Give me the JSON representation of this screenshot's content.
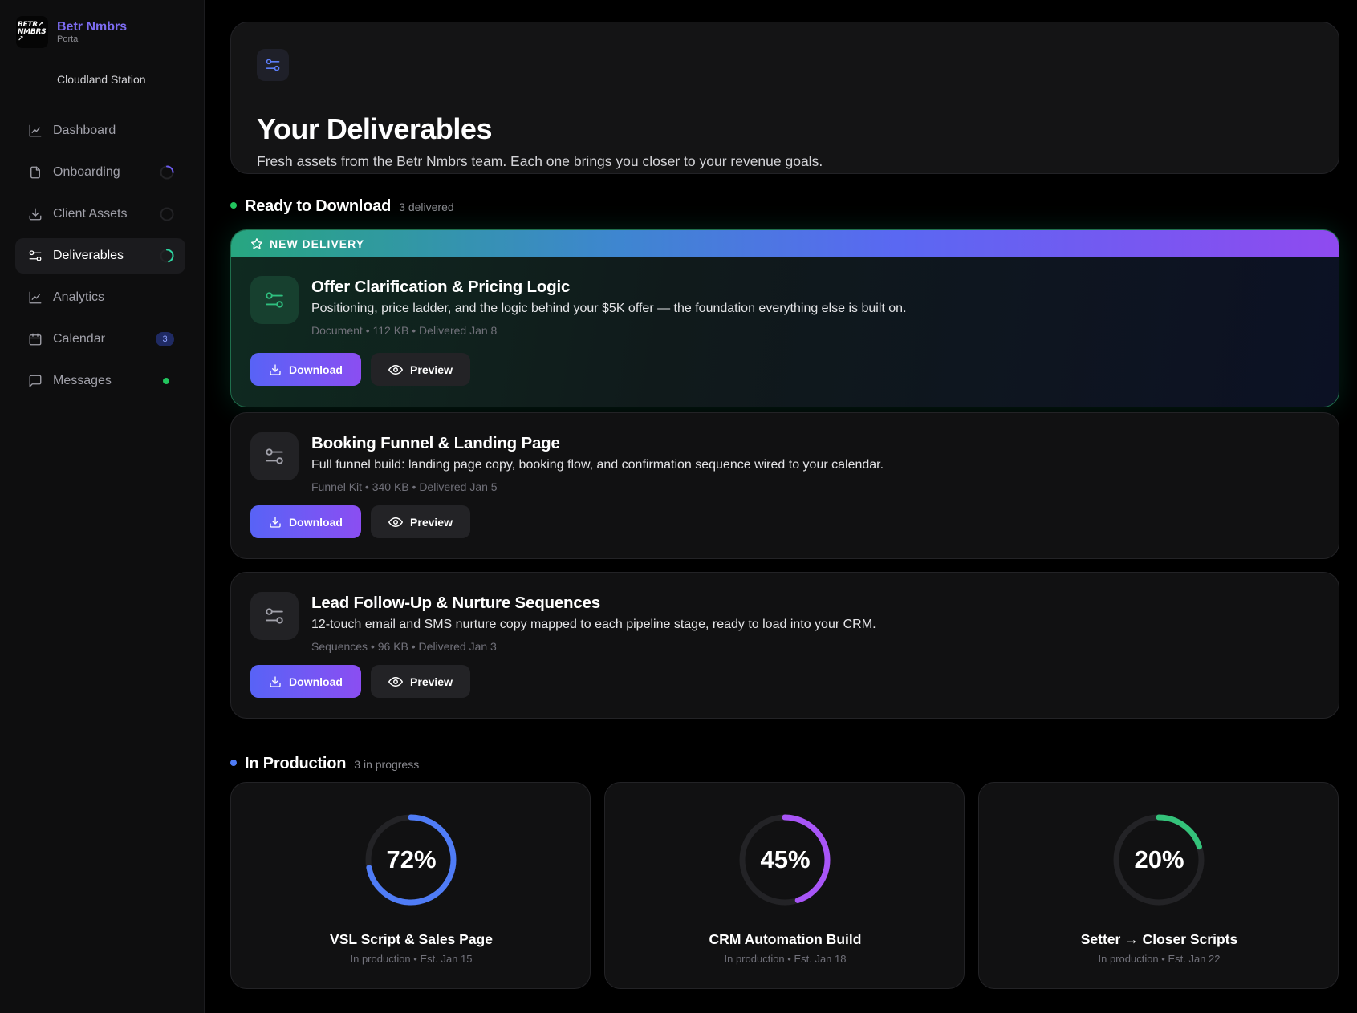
{
  "brand": {
    "logo_line1": "BETR↗",
    "logo_line2": "NMBRS",
    "logo_line3": "↗",
    "name": "Betr Nmbrs",
    "subtitle": "Portal"
  },
  "workspace": "Cloudland Station",
  "sidebar": {
    "items": [
      {
        "label": "Dashboard",
        "icon": "chart-line-icon"
      },
      {
        "label": "Onboarding",
        "icon": "document-icon",
        "progress": 0.25
      },
      {
        "label": "Client Assets",
        "icon": "download-icon",
        "progress": 0.0
      },
      {
        "label": "Deliverables",
        "icon": "sliders-icon",
        "progress": 0.45,
        "active": true
      },
      {
        "label": "Analytics",
        "icon": "chart-line-icon"
      },
      {
        "label": "Calendar",
        "icon": "calendar-icon",
        "badge": "3"
      },
      {
        "label": "Messages",
        "icon": "message-icon",
        "status": "online"
      }
    ]
  },
  "colors": {
    "accent": "#6366f1",
    "purple": "#8b5cf6",
    "green": "#22c55e",
    "blue": "#4f7cf6"
  },
  "hero": {
    "title": "Your Deliverables",
    "subtitle": "Fresh assets from the Betr Nmbrs team. Each one brings you closer to your revenue goals."
  },
  "ready": {
    "title": "Ready to Download",
    "count": "3 delivered",
    "ribbon": "NEW DELIVERY",
    "download_label": "Download",
    "preview_label": "Preview",
    "items": [
      {
        "title": "Offer Clarification & Pricing Logic",
        "description": "Positioning, price ladder, and the logic behind your $5K offer — the foundation everything else is built on.",
        "meta": "Document • 112 KB • Delivered Jan 8"
      },
      {
        "title": "Booking Funnel & Landing Page",
        "description": "Full funnel build: landing page copy, booking flow, and confirmation sequence wired to your calendar.",
        "meta": "Funnel Kit • 340 KB • Delivered Jan 5"
      },
      {
        "title": "Lead Follow-Up & Nurture Sequences",
        "description": "12-touch email and SMS nurture copy mapped to each pipeline stage, ready to load into your CRM.",
        "meta": "Sequences • 96 KB • Delivered Jan 3"
      }
    ]
  },
  "production": {
    "title": "In Production",
    "count": "3 in progress",
    "items": [
      {
        "percent_label": "72%",
        "progress": 0.72,
        "color": "#4f7cf6",
        "title": "VSL Script & Sales Page",
        "meta": "In production • Est. Jan 15"
      },
      {
        "percent_label": "45%",
        "progress": 0.45,
        "color": "#a855f7",
        "title": "CRM Automation Build",
        "meta": "In production • Est. Jan 18"
      },
      {
        "percent_label": "20%",
        "progress": 0.2,
        "color": "#34c27a",
        "title": "Setter → Closer Scripts",
        "meta": "In production • Est. Jan 22"
      }
    ]
  }
}
